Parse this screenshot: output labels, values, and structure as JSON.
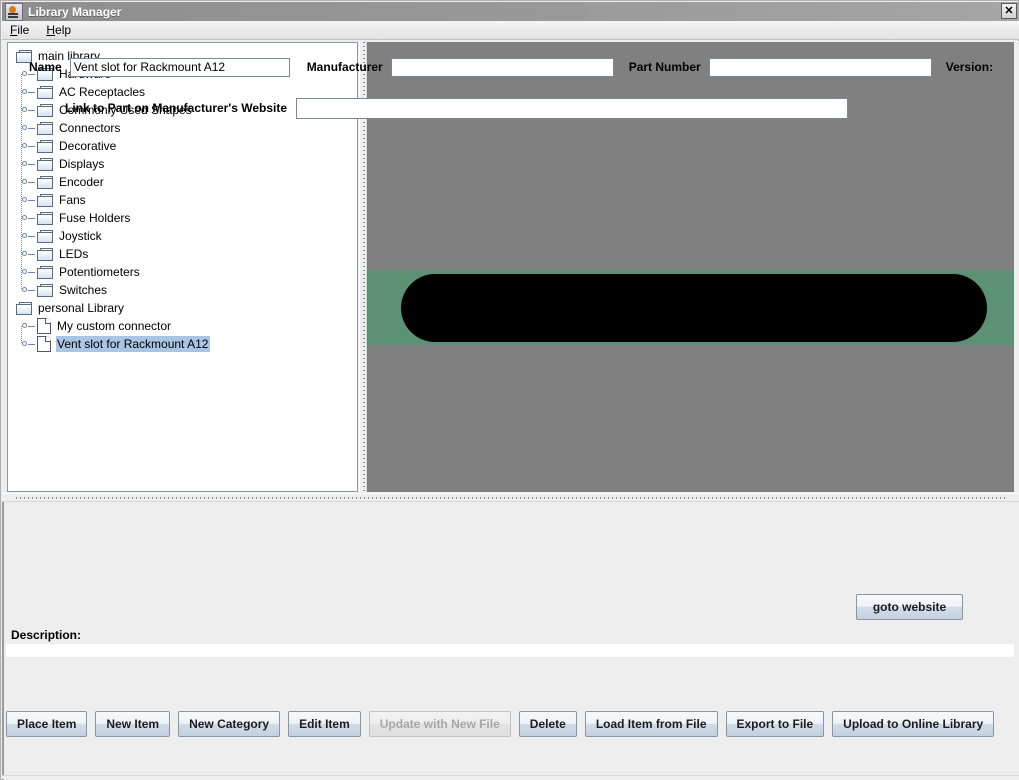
{
  "window": {
    "title": "Library Manager",
    "icon": "java-coffee-cup-icon",
    "close_label": "✕"
  },
  "menubar": {
    "items": [
      {
        "label": "File",
        "mnemonic": "F"
      },
      {
        "label": "Help",
        "mnemonic": "H"
      }
    ]
  },
  "tree": {
    "nodes": [
      {
        "label": "main library",
        "depth": 0,
        "type": "folder",
        "handle": false,
        "selected": false
      },
      {
        "label": "Hardware",
        "depth": 1,
        "type": "folder",
        "handle": true,
        "selected": false
      },
      {
        "label": "AC Receptacles",
        "depth": 1,
        "type": "folder",
        "handle": true,
        "selected": false
      },
      {
        "label": "Commonly Used Shapes",
        "depth": 1,
        "type": "folder",
        "handle": true,
        "selected": false
      },
      {
        "label": "Connectors",
        "depth": 1,
        "type": "folder",
        "handle": true,
        "selected": false
      },
      {
        "label": "Decorative",
        "depth": 1,
        "type": "folder",
        "handle": true,
        "selected": false
      },
      {
        "label": "Displays",
        "depth": 1,
        "type": "folder",
        "handle": true,
        "selected": false
      },
      {
        "label": "Encoder",
        "depth": 1,
        "type": "folder",
        "handle": true,
        "selected": false
      },
      {
        "label": "Fans",
        "depth": 1,
        "type": "folder",
        "handle": true,
        "selected": false
      },
      {
        "label": "Fuse Holders",
        "depth": 1,
        "type": "folder",
        "handle": true,
        "selected": false
      },
      {
        "label": "Joystick",
        "depth": 1,
        "type": "folder",
        "handle": true,
        "selected": false
      },
      {
        "label": "LEDs",
        "depth": 1,
        "type": "folder",
        "handle": true,
        "selected": false
      },
      {
        "label": "Potentiometers",
        "depth": 1,
        "type": "folder",
        "handle": true,
        "selected": false
      },
      {
        "label": "Switches",
        "depth": 1,
        "type": "folder",
        "handle": true,
        "selected": false
      },
      {
        "label": "personal Library",
        "depth": 0,
        "type": "folder",
        "handle": false,
        "selected": false
      },
      {
        "label": "My custom connector",
        "depth": 1,
        "type": "file",
        "handle": true,
        "selected": false
      },
      {
        "label": "Vent slot for Rackmount A12",
        "depth": 1,
        "type": "file",
        "handle": true,
        "selected": true
      }
    ]
  },
  "preview": {
    "background_color": "#808080",
    "band_color": "#5d9173",
    "shape_color": "#000000",
    "shape": "rounded-rectangle-vent-slot"
  },
  "detail": {
    "name_label": "Name",
    "name_value": "Vent slot for Rackmount A12",
    "manufacturer_label": "Manufacturer",
    "manufacturer_value": "",
    "part_number_label": "Part Number",
    "part_number_value": "",
    "version_label": "Version:",
    "link_label": "Link to Part on Manufacturer's Website",
    "link_value": "",
    "goto_website_label": "goto website",
    "description_label": "Description:",
    "description_value": ""
  },
  "buttons": [
    {
      "label": "Place Item",
      "enabled": true
    },
    {
      "label": "New Item",
      "enabled": true
    },
    {
      "label": "New Category",
      "enabled": true
    },
    {
      "label": "Edit Item",
      "enabled": true
    },
    {
      "label": "Update with New File",
      "enabled": false
    },
    {
      "label": "Delete",
      "enabled": true
    },
    {
      "label": "Load Item from File",
      "enabled": true
    },
    {
      "label": "Export to File",
      "enabled": true
    },
    {
      "label": "Upload to Online Library",
      "enabled": true
    }
  ]
}
